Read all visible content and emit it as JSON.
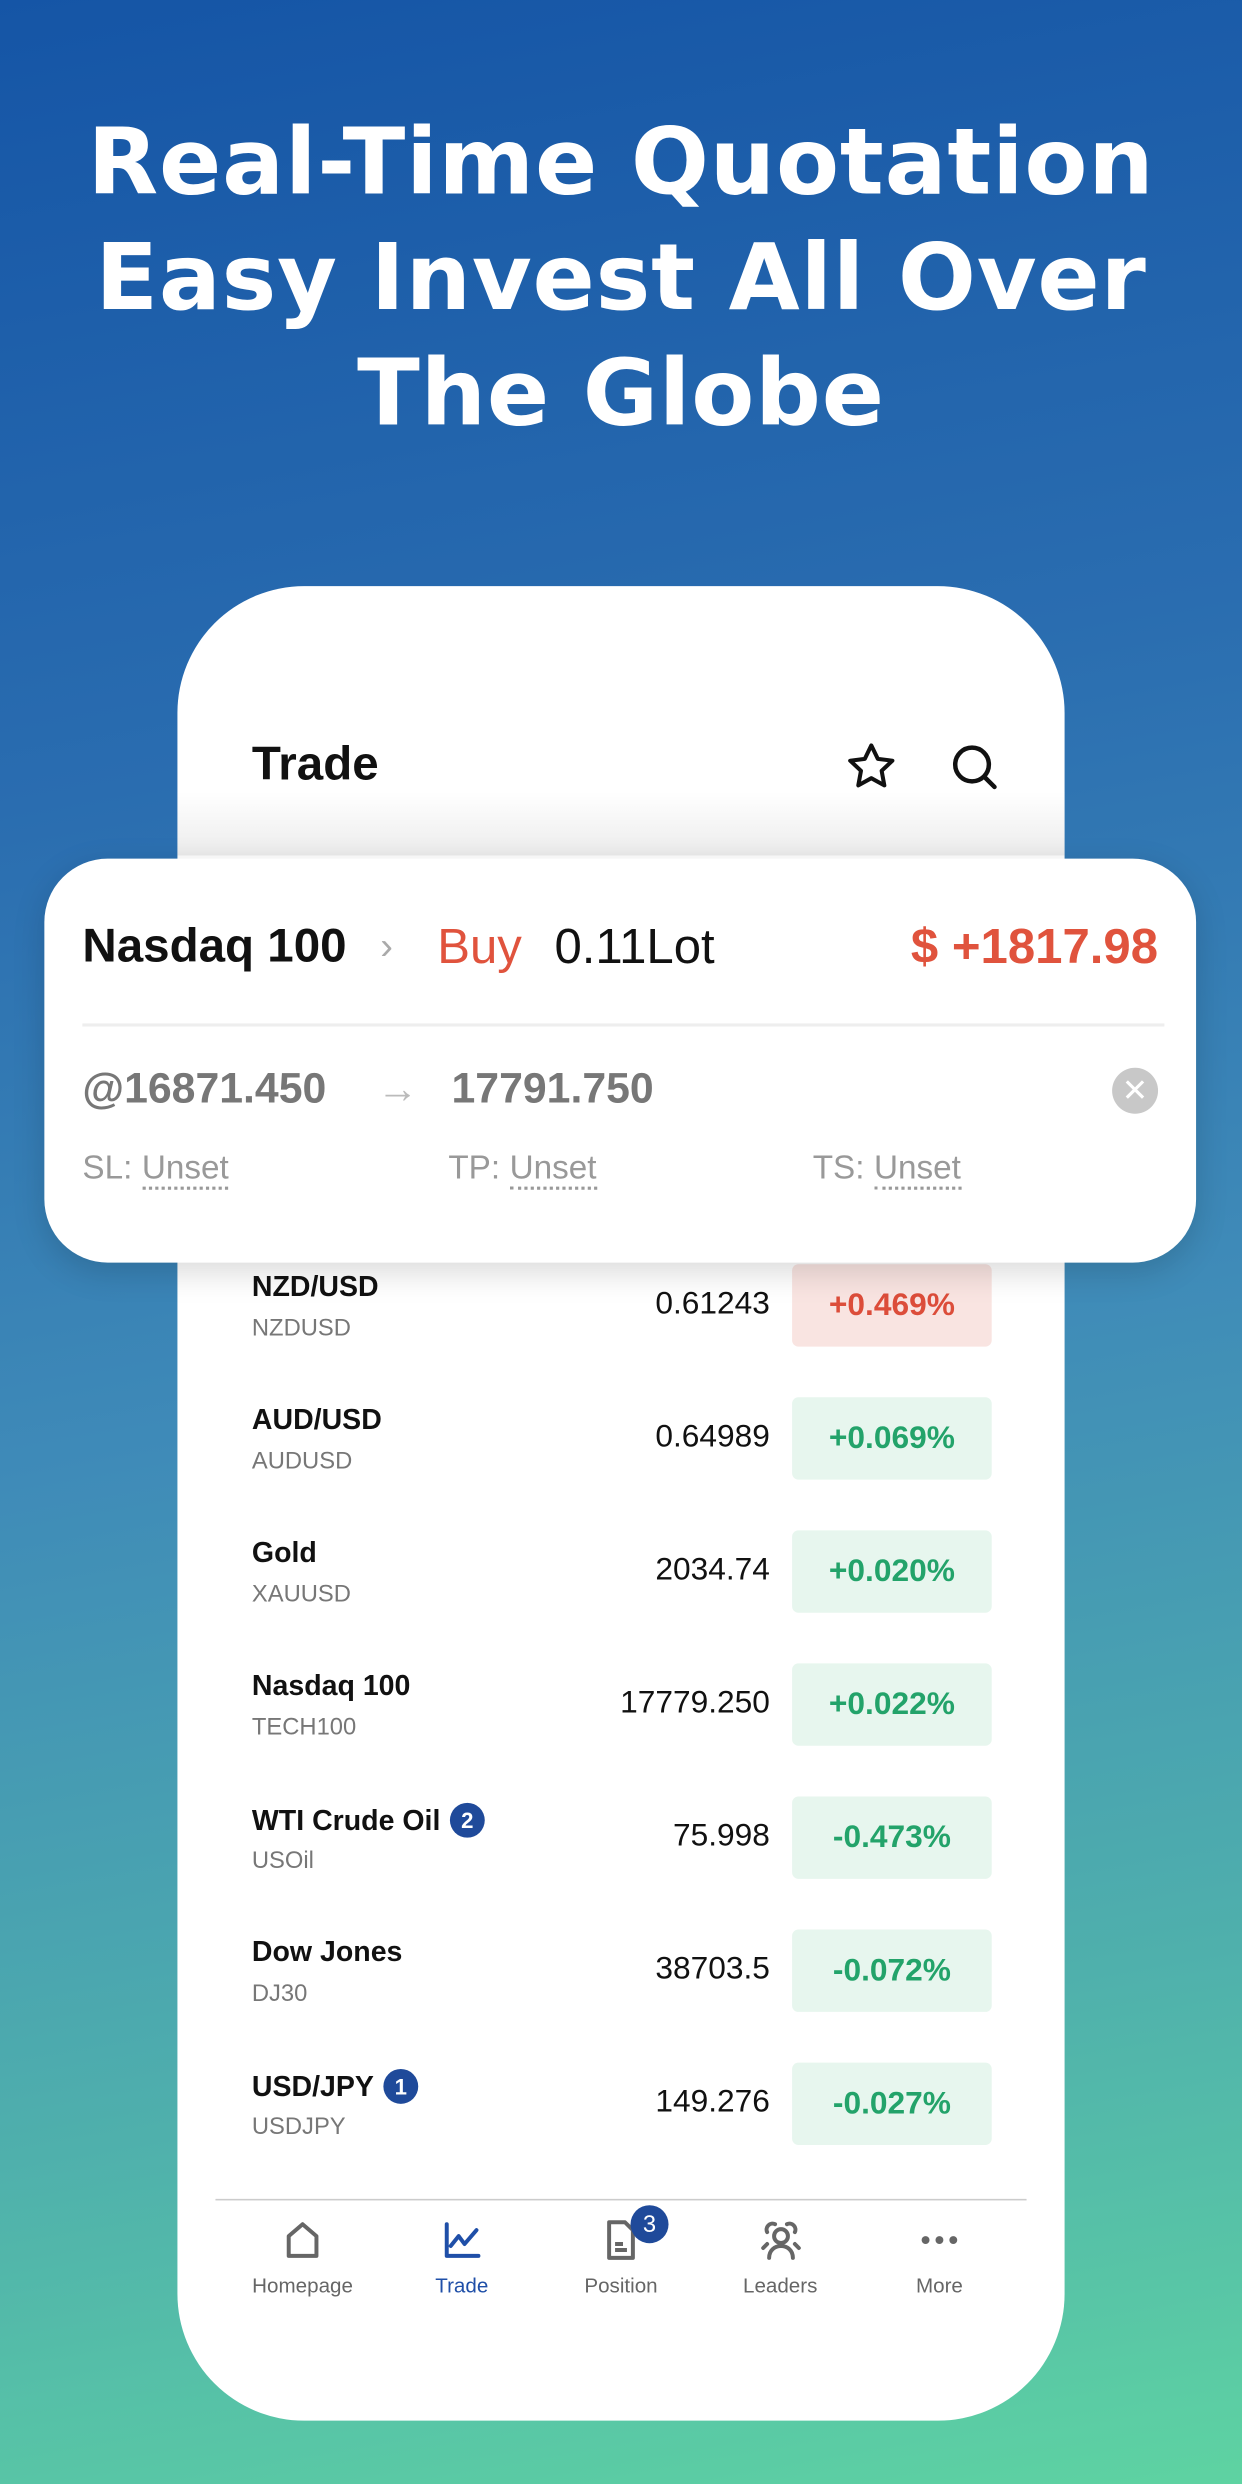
{
  "headline": [
    "Real-Time Quotation",
    "Easy Invest All Over",
    "The Globe"
  ],
  "screen": {
    "title": "Trade",
    "icons": [
      "star-icon",
      "search-icon"
    ]
  },
  "position_card": {
    "instrument": "Nasdaq 100",
    "side": "Buy",
    "lot": "0.11Lot",
    "pnl": "$ +1817.98",
    "open_price": "@16871.450",
    "current_price": "17791.750",
    "sl_label": "SL:",
    "sl_value": "Unset",
    "tp_label": "TP:",
    "tp_value": "Unset",
    "ts_label": "TS:",
    "ts_value": "Unset"
  },
  "quotes": [
    {
      "name": "NZD/USD",
      "code": "NZDUSD",
      "price": "0.61243",
      "change": "+0.469%",
      "dir": "down"
    },
    {
      "name": "AUD/USD",
      "code": "AUDUSD",
      "price": "0.64989",
      "change": "+0.069%",
      "dir": "up"
    },
    {
      "name": "Gold",
      "code": "XAUUSD",
      "price": "2034.74",
      "change": "+0.020%",
      "dir": "up"
    },
    {
      "name": "Nasdaq 100",
      "code": "TECH100",
      "price": "17779.250",
      "change": "+0.022%",
      "dir": "up"
    },
    {
      "name": "WTI Crude Oil",
      "code": "USOil",
      "price": "75.998",
      "change": "-0.473%",
      "dir": "up",
      "count": "2"
    },
    {
      "name": "Dow Jones",
      "code": "DJ30",
      "price": "38703.5",
      "change": "-0.072%",
      "dir": "up"
    },
    {
      "name": "USD/JPY",
      "code": "USDJPY",
      "price": "149.276",
      "change": "-0.027%",
      "dir": "up",
      "count": "1"
    }
  ],
  "nav": {
    "items": [
      {
        "label": "Homepage",
        "icon": "home-icon"
      },
      {
        "label": "Trade",
        "icon": "chart-icon",
        "active": true
      },
      {
        "label": "Position",
        "icon": "document-icon",
        "badge": "3"
      },
      {
        "label": "Leaders",
        "icon": "users-icon"
      },
      {
        "label": "More",
        "icon": "more-icon"
      }
    ]
  },
  "colors": {
    "accent": "#1f4fa8",
    "loss": "#e0533d",
    "gain": "#23a36a"
  }
}
